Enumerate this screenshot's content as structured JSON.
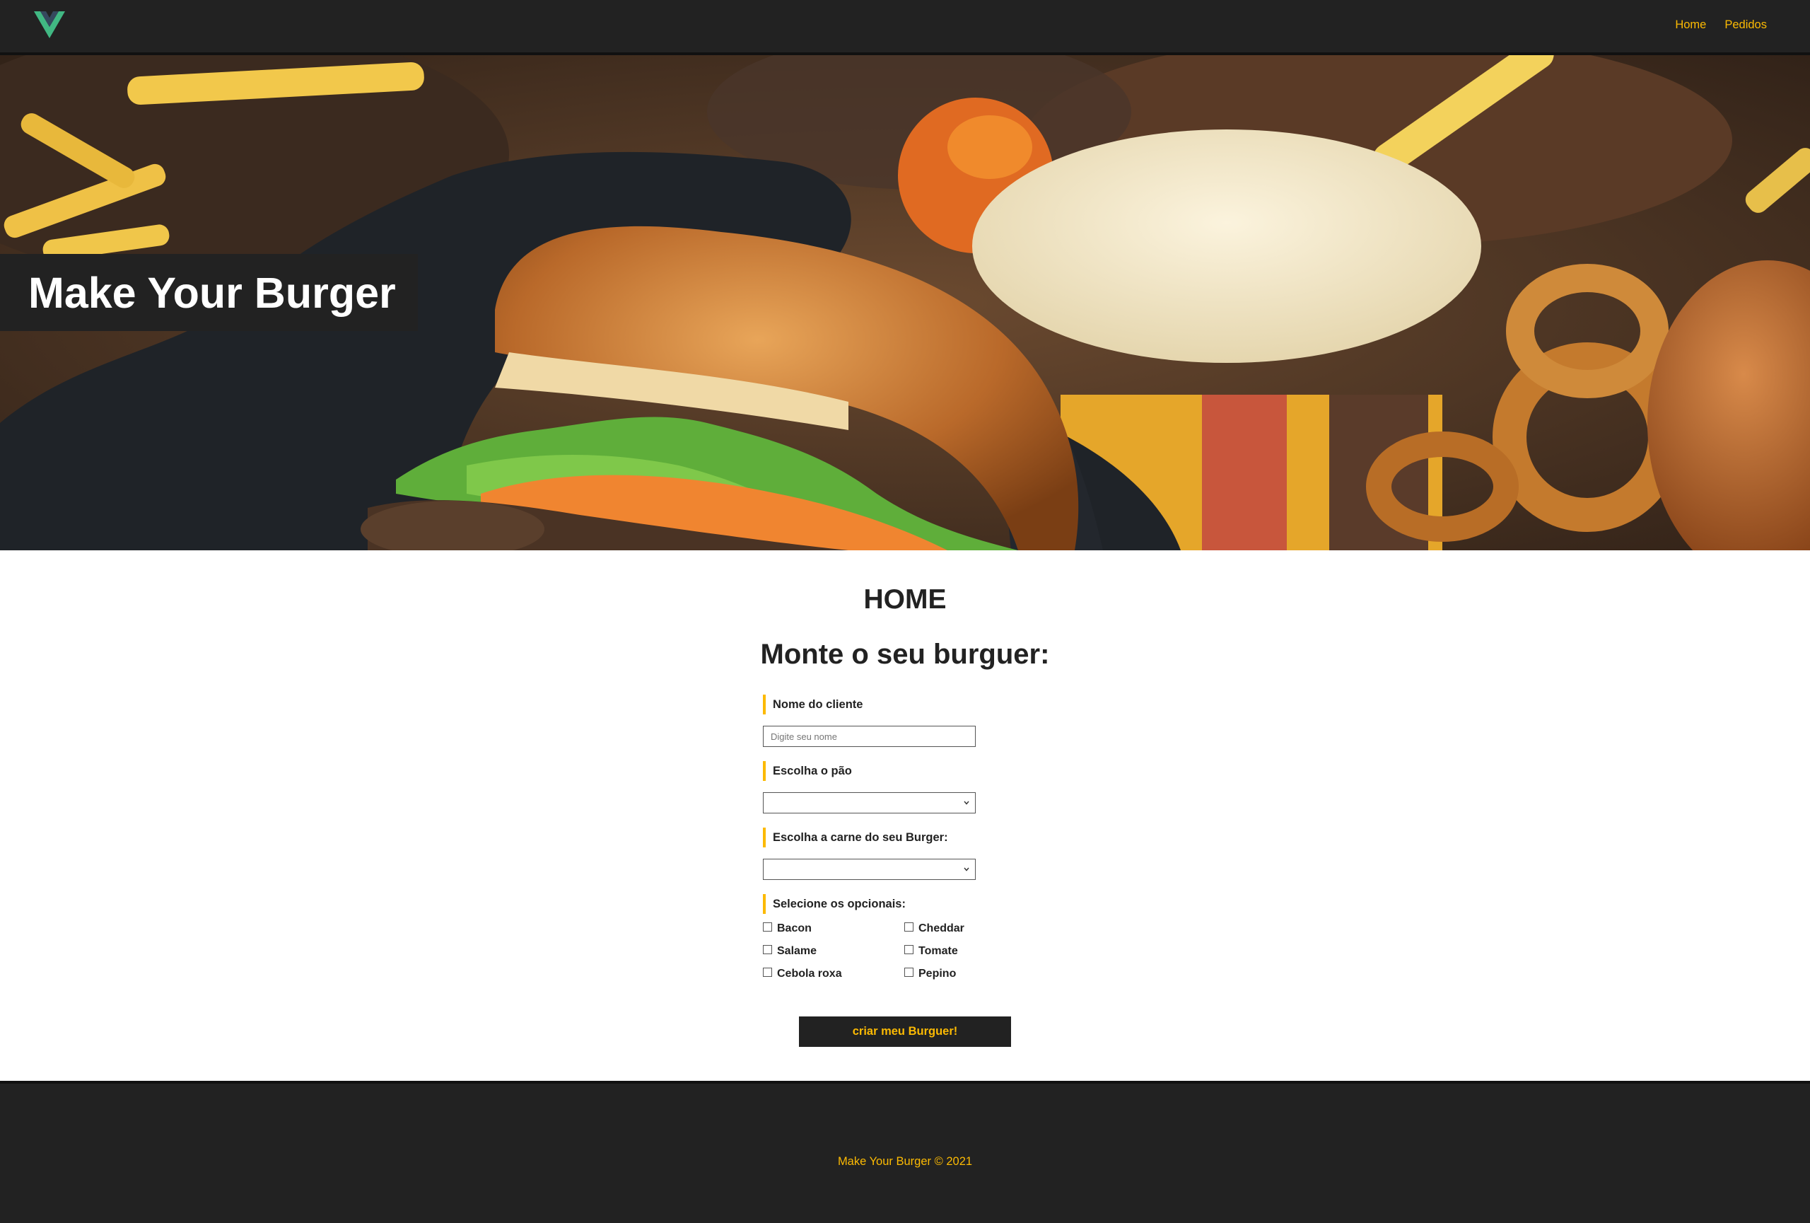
{
  "navbar": {
    "logo_icon": "vue-logo-icon",
    "links": [
      {
        "label": "Home"
      },
      {
        "label": "Pedidos"
      }
    ],
    "link_color": "#fcba03"
  },
  "hero": {
    "title": "Make Your Burger"
  },
  "main": {
    "page_title": "HOME",
    "form_title": "Monte o seu burguer:",
    "fields": {
      "name_label": "Nome do cliente",
      "name_placeholder": "Digite seu nome",
      "name_value": "",
      "bread_label": "Escolha o pão",
      "bread_selected": "",
      "meat_label": "Escolha a carne do seu Burger:",
      "meat_selected": "",
      "optionals_label": "Selecione os opcionais:"
    },
    "optionals": [
      {
        "label": "Bacon",
        "checked": false
      },
      {
        "label": "Cheddar",
        "checked": false
      },
      {
        "label": "Salame",
        "checked": false
      },
      {
        "label": "Tomate",
        "checked": false
      },
      {
        "label": "Cebola roxa",
        "checked": false
      },
      {
        "label": "Pepino",
        "checked": false
      }
    ],
    "submit_label": "criar meu Burguer!"
  },
  "footer": {
    "text": "Make Your Burger © 2021"
  },
  "colors": {
    "dark": "#222222",
    "accent": "#fcba03"
  }
}
